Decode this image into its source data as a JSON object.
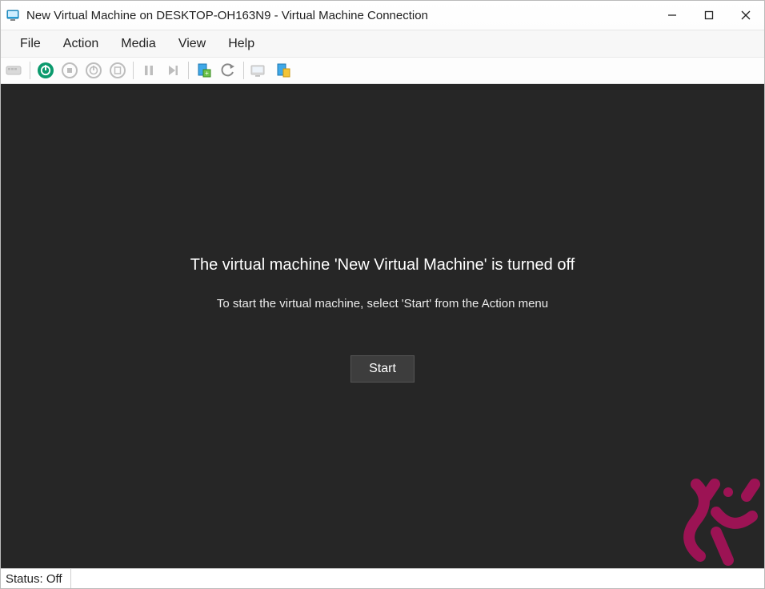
{
  "window": {
    "title": "New Virtual Machine on DESKTOP-OH163N9 - Virtual Machine Connection"
  },
  "menu": {
    "items": [
      "File",
      "Action",
      "Media",
      "View",
      "Help"
    ]
  },
  "toolbar": {
    "ctrl_alt_del": "ctrl-alt-del",
    "start": "start",
    "turn_off": "turn-off",
    "shutdown": "shutdown",
    "save": "save",
    "pause": "pause",
    "reset": "reset",
    "checkpoint": "checkpoint",
    "revert": "revert",
    "enhanced_session": "enhanced-session",
    "share": "share"
  },
  "main": {
    "heading": "The virtual machine 'New Virtual Machine' is turned off",
    "subtext": "To start the virtual machine, select 'Start' from the Action menu",
    "start_label": "Start"
  },
  "status": {
    "text": "Status: Off"
  },
  "colors": {
    "content_bg": "#262626",
    "start_green": "#0b9a6d",
    "watermark": "#a31357"
  }
}
